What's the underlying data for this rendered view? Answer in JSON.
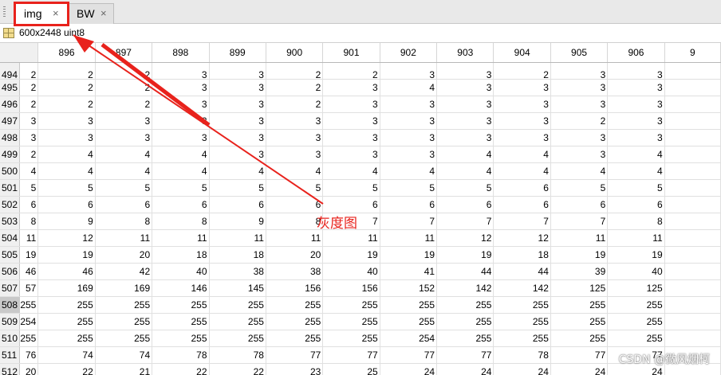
{
  "tabs": [
    {
      "label": "img",
      "active": true
    },
    {
      "label": "BW",
      "active": false
    }
  ],
  "close_glyph": "×",
  "variable_info": "600x2448 uint8",
  "columns": [
    "896",
    "897",
    "898",
    "899",
    "900",
    "901",
    "902",
    "903",
    "904",
    "905",
    "906",
    "9"
  ],
  "rows": [
    {
      "index": "494",
      "first": "2",
      "values": [
        "2",
        "2",
        "3",
        "3",
        "2",
        "2",
        "3",
        "3",
        "2",
        "3",
        "3"
      ]
    },
    {
      "index": "495",
      "first": "2",
      "values": [
        "2",
        "2",
        "3",
        "3",
        "2",
        "3",
        "4",
        "3",
        "3",
        "3",
        "3"
      ]
    },
    {
      "index": "496",
      "first": "2",
      "values": [
        "2",
        "2",
        "3",
        "3",
        "2",
        "3",
        "3",
        "3",
        "3",
        "3",
        "3"
      ]
    },
    {
      "index": "497",
      "first": "3",
      "values": [
        "3",
        "3",
        "3",
        "3",
        "3",
        "3",
        "3",
        "3",
        "3",
        "2",
        "3"
      ]
    },
    {
      "index": "498",
      "first": "3",
      "values": [
        "3",
        "3",
        "3",
        "3",
        "3",
        "3",
        "3",
        "3",
        "3",
        "3",
        "3"
      ]
    },
    {
      "index": "499",
      "first": "2",
      "values": [
        "4",
        "4",
        "4",
        "3",
        "3",
        "3",
        "3",
        "4",
        "4",
        "3",
        "4"
      ]
    },
    {
      "index": "500",
      "first": "4",
      "values": [
        "4",
        "4",
        "4",
        "4",
        "4",
        "4",
        "4",
        "4",
        "4",
        "4",
        "4"
      ]
    },
    {
      "index": "501",
      "first": "5",
      "values": [
        "5",
        "5",
        "5",
        "5",
        "5",
        "5",
        "5",
        "5",
        "6",
        "5",
        "5"
      ]
    },
    {
      "index": "502",
      "first": "6",
      "values": [
        "6",
        "6",
        "6",
        "6",
        "6",
        "6",
        "6",
        "6",
        "6",
        "6",
        "6"
      ]
    },
    {
      "index": "503",
      "first": "8",
      "values": [
        "9",
        "8",
        "8",
        "9",
        "8",
        "7",
        "7",
        "7",
        "7",
        "7",
        "8"
      ]
    },
    {
      "index": "504",
      "first": "11",
      "values": [
        "12",
        "11",
        "11",
        "11",
        "11",
        "11",
        "11",
        "12",
        "12",
        "11",
        "11"
      ]
    },
    {
      "index": "505",
      "first": "19",
      "values": [
        "19",
        "20",
        "18",
        "18",
        "20",
        "19",
        "19",
        "19",
        "18",
        "19",
        "19"
      ]
    },
    {
      "index": "506",
      "first": "46",
      "values": [
        "46",
        "42",
        "40",
        "38",
        "38",
        "40",
        "41",
        "44",
        "44",
        "39",
        "40"
      ]
    },
    {
      "index": "507",
      "first": "57",
      "values": [
        "169",
        "169",
        "146",
        "145",
        "156",
        "156",
        "152",
        "142",
        "142",
        "125",
        "125"
      ]
    },
    {
      "index": "508",
      "first": "255",
      "values": [
        "255",
        "255",
        "255",
        "255",
        "255",
        "255",
        "255",
        "255",
        "255",
        "255",
        "255"
      ],
      "selected": true
    },
    {
      "index": "509",
      "first": "254",
      "values": [
        "255",
        "255",
        "255",
        "255",
        "255",
        "255",
        "255",
        "255",
        "255",
        "255",
        "255"
      ]
    },
    {
      "index": "510",
      "first": "255",
      "values": [
        "255",
        "255",
        "255",
        "255",
        "255",
        "255",
        "254",
        "255",
        "255",
        "255",
        "255"
      ]
    },
    {
      "index": "511",
      "first": "76",
      "values": [
        "74",
        "74",
        "78",
        "78",
        "77",
        "77",
        "77",
        "77",
        "78",
        "77",
        "77"
      ]
    },
    {
      "index": "512",
      "first": "20",
      "values": [
        "22",
        "21",
        "22",
        "22",
        "23",
        "25",
        "24",
        "24",
        "24",
        "24",
        "24"
      ]
    }
  ],
  "annotation": {
    "label": "灰度图",
    "color": "#e8221c"
  },
  "watermark": "CSDN @微风烟柯"
}
